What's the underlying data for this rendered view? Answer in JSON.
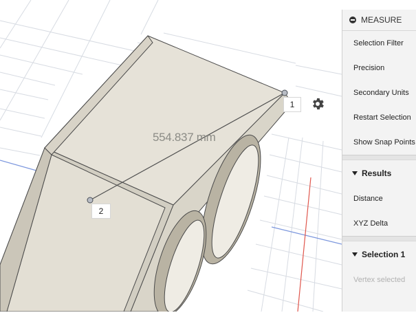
{
  "viewport": {
    "measurement_label": "554.837 mm",
    "point1_label": "1",
    "point2_label": "2",
    "settings_icon": "gear-icon"
  },
  "panel": {
    "title": "MEASURE",
    "collapse_icon": "minus-circle-icon",
    "options": [
      {
        "label": "Selection Filter"
      },
      {
        "label": "Precision"
      },
      {
        "label": "Secondary Units"
      },
      {
        "label": "Restart Selection"
      },
      {
        "label": "Show Snap Points"
      }
    ],
    "results": {
      "heading": "Results",
      "items": [
        {
          "label": "Distance"
        },
        {
          "label": "XYZ Delta"
        }
      ]
    },
    "selection1": {
      "heading": "Selection 1",
      "status": "Vertex selected"
    }
  },
  "colors": {
    "block_top": "#e6e2d8",
    "block_side": "#d6d1c4",
    "edge": "#3a3a3a",
    "grid": "#d4d8df",
    "red_axis": "#e0443a",
    "blue_axis": "#3a6fd8",
    "panel_bg": "#f3f3f3"
  }
}
